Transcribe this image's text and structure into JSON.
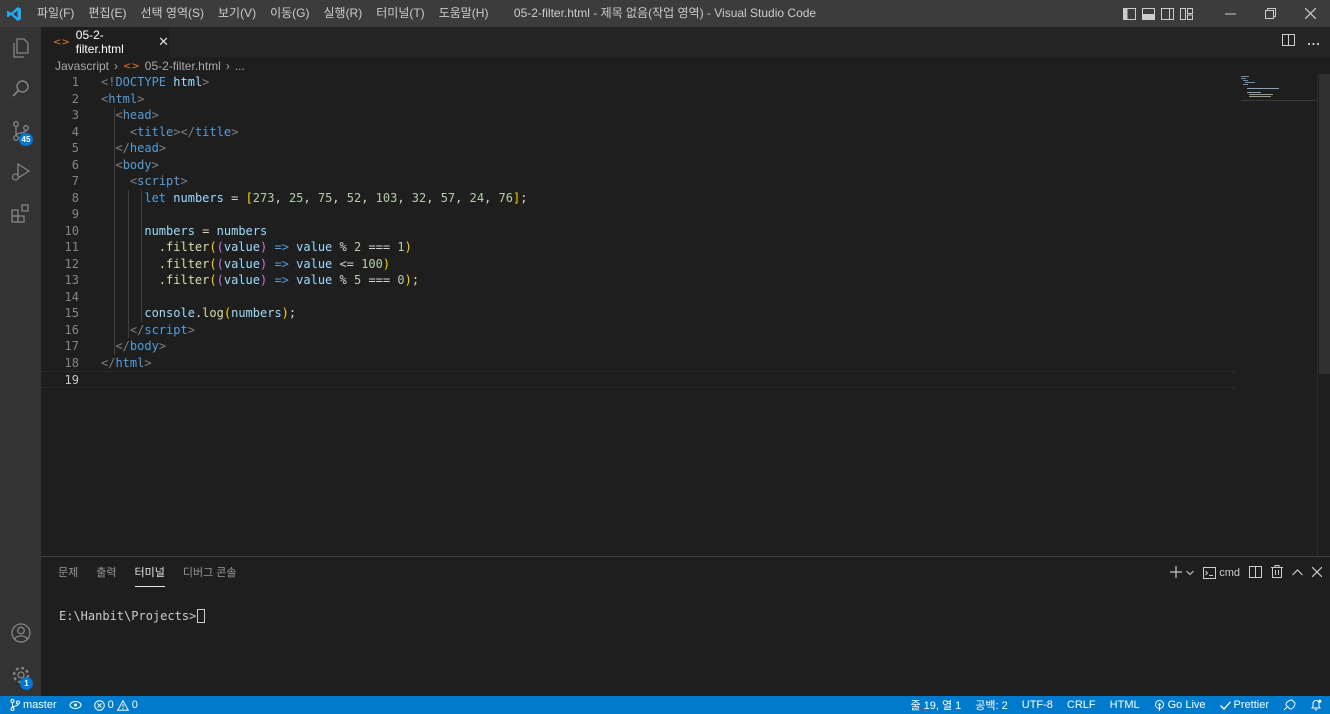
{
  "titlebar": {
    "menu": [
      "파일(F)",
      "편집(E)",
      "선택 영역(S)",
      "보기(V)",
      "이동(G)",
      "실행(R)",
      "터미널(T)",
      "도움말(H)"
    ],
    "title": "05-2-filter.html - 제목 없음(작업 영역) - Visual Studio Code"
  },
  "activitybar": {
    "scm_badge": "45",
    "settings_badge": "1"
  },
  "tab": {
    "label": "05-2-filter.html",
    "close": "✕"
  },
  "breadcrumb": {
    "folder": "Javascript",
    "file": "05-2-filter.html",
    "more": "..."
  },
  "editor": {
    "line_numbers": [
      "1",
      "2",
      "3",
      "4",
      "5",
      "6",
      "7",
      "8",
      "9",
      "10",
      "11",
      "12",
      "13",
      "14",
      "15",
      "16",
      "17",
      "18",
      "19"
    ],
    "current_line": 19
  },
  "panel": {
    "tabs": [
      "문제",
      "출력",
      "터미널",
      "디버그 콘솔"
    ],
    "active_tab": "터미널",
    "shell": "cmd",
    "terminal_prompt": "E:\\Hanbit\\Projects>"
  },
  "statusbar": {
    "branch": "master",
    "errors": "0",
    "warnings": "0",
    "position": "줄 19, 열 1",
    "spaces": "공백: 2",
    "encoding": "UTF-8",
    "eol": "CRLF",
    "language": "HTML",
    "golive": "Go Live",
    "prettier": "Prettier"
  }
}
